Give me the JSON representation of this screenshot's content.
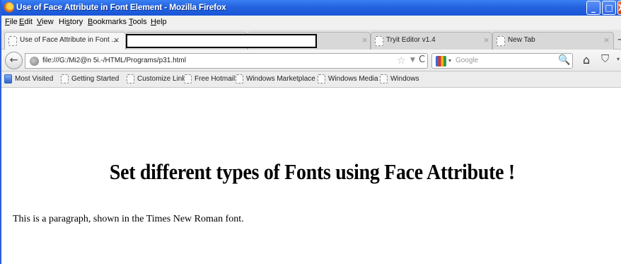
{
  "window": {
    "title": "Use of Face Attribute in Font Element - Mozilla Firefox",
    "controls": {
      "minimize": "_",
      "maximize": "□",
      "close": "X"
    }
  },
  "menu": {
    "items": [
      {
        "accel": "F",
        "rest": "ile"
      },
      {
        "accel": "E",
        "rest": "dit"
      },
      {
        "accel": "V",
        "rest": "iew"
      },
      {
        "accel": "",
        "prefix": "Hi",
        "accel_mid": "s",
        "rest": "tory"
      },
      {
        "accel": "B",
        "rest": "ookmarks"
      },
      {
        "accel": "T",
        "rest": "ools"
      },
      {
        "accel": "H",
        "rest": "elp"
      }
    ]
  },
  "tabs": [
    {
      "label": "Use of Face Attribute in Font ...",
      "close": "×",
      "active": true
    },
    {
      "label": "",
      "close": "×",
      "active": false
    },
    {
      "label": "Tryit Editor v1.4",
      "close": "×",
      "active": false
    },
    {
      "label": "New Tab",
      "close": "×",
      "active": false
    }
  ],
  "new_tab_symbol": "+",
  "navbar": {
    "back_symbol": "←",
    "url": "file:///G:/Mi2@n 5i.-/HTML/Programs/p31.html",
    "star_symbol": "☆",
    "dropdown_symbol": "▼",
    "reload_symbol": "C",
    "search_placeholder": "Google",
    "search_dropdown_symbol": "▾",
    "search_symbol": "🔍",
    "home_symbol": "⌂",
    "pocket_symbol": "⛉",
    "more_symbol": "▾"
  },
  "bookmarks": [
    {
      "label": "Most Visited",
      "icon": "most-visited-icon"
    },
    {
      "label": "Getting Started",
      "icon": "page-icon"
    },
    {
      "label": "Customize Links",
      "icon": "page-icon"
    },
    {
      "label": "Free Hotmail",
      "icon": "page-icon"
    },
    {
      "label": "Windows Marketplace",
      "icon": "page-icon"
    },
    {
      "label": "Windows Media",
      "icon": "page-icon"
    },
    {
      "label": "Windows",
      "icon": "page-icon"
    }
  ],
  "page": {
    "heading": "Set different types of Fonts using Face Attribute !",
    "paragraph": "This is a paragraph, shown in the Times New Roman font."
  }
}
